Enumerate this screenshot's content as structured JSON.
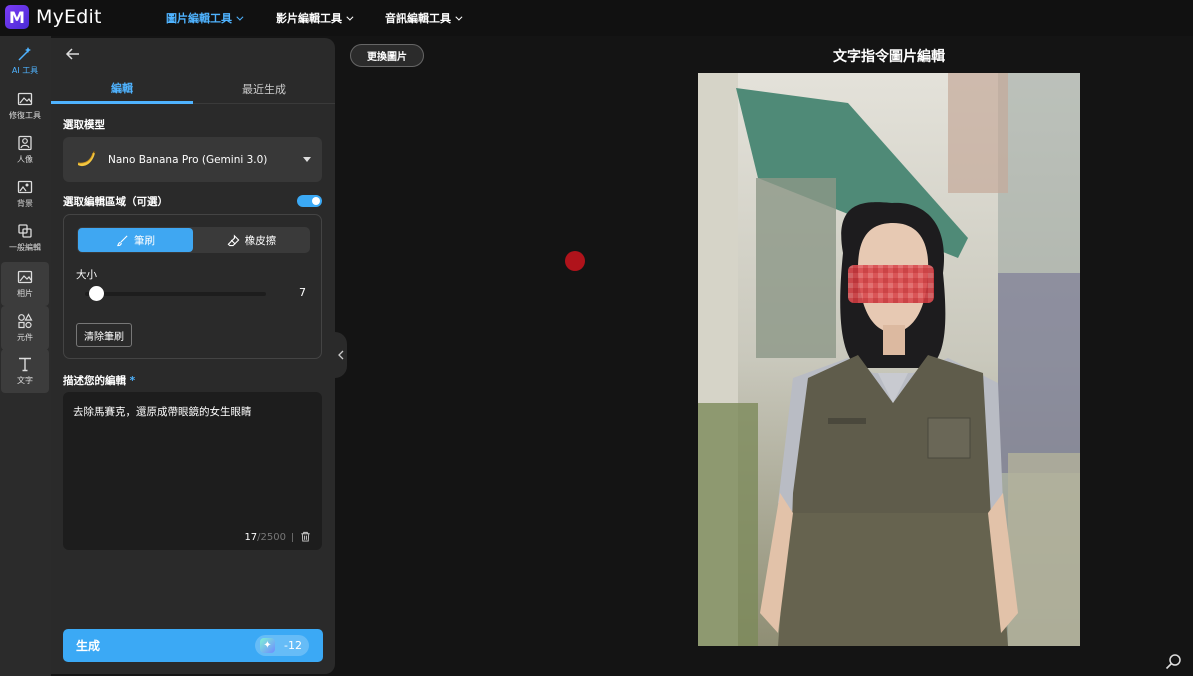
{
  "app": {
    "name": "MyEdit",
    "logo_letter": "M"
  },
  "topnav": [
    {
      "label": "圖片編輯工具",
      "active": true
    },
    {
      "label": "影片編輯工具",
      "active": false
    },
    {
      "label": "音訊編輯工具",
      "active": false
    }
  ],
  "rail": [
    {
      "label": "AI 工具",
      "icon": "ai-wand-icon"
    },
    {
      "label": "修復工具",
      "icon": "image-fix-icon"
    },
    {
      "label": "人像",
      "icon": "portrait-icon"
    },
    {
      "label": "背景",
      "icon": "background-icon"
    },
    {
      "label": "一般編輯",
      "icon": "edit-icon"
    },
    {
      "label": "相片",
      "icon": "photo-icon"
    },
    {
      "label": "元件",
      "icon": "shapes-icon"
    },
    {
      "label": "文字",
      "icon": "text-icon"
    }
  ],
  "panel": {
    "tabs": [
      "編輯",
      "最近生成"
    ],
    "model_label": "選取模型",
    "model_value": "Nano Banana Pro (Gemini 3.0)",
    "area_label": "選取編輯區域（可選）",
    "area_enabled": true,
    "brush_label": "筆刷",
    "eraser_label": "橡皮擦",
    "size_label": "大小",
    "size_value": "7",
    "clear_label": "清除筆刷",
    "desc_label": "描述您的編輯",
    "desc_required": "*",
    "desc_text": "去除馬賽克，還原成帶眼鏡的女生眼睛",
    "char_count": "17",
    "char_max": "/2500",
    "generate_label": "生成",
    "credit_cost": "-12"
  },
  "canvas": {
    "change_image_label": "更換圖片",
    "title": "文字指令圖片編輯"
  },
  "colors": {
    "accent": "#3ba9f5",
    "brush_dot": "#b0131b"
  }
}
